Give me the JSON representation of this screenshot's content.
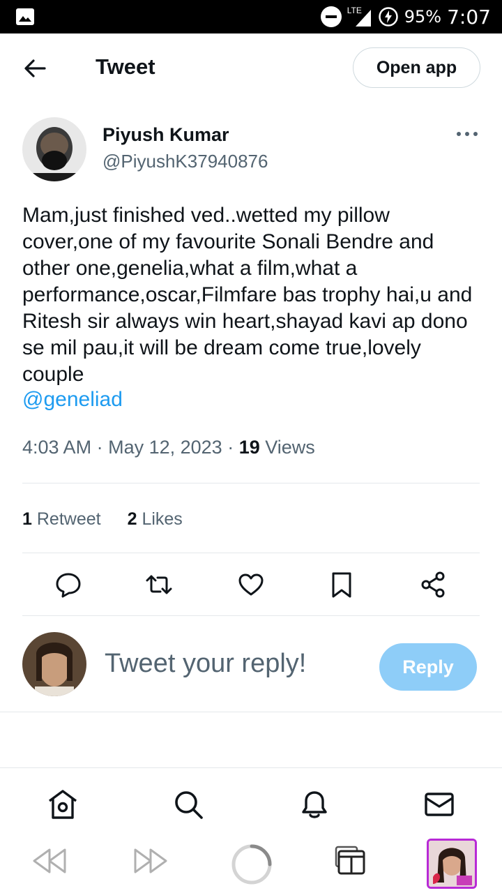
{
  "status_bar": {
    "network": "LTE",
    "battery": "95%",
    "time": "7:07"
  },
  "header": {
    "title": "Tweet",
    "open_app_label": "Open app"
  },
  "tweet": {
    "author_name": "Piyush Kumar",
    "author_handle": "@PiyushK37940876",
    "text": "Mam,just finished ved..wetted my pillow cover,one of my favourite Sonali Bendre and other one,genelia,what a film,what a performance,oscar,Filmfare bas trophy hai,u and Ritesh sir always win heart,shayad kavi ap dono se mil pau,it will be dream come true,lovely couple",
    "mention": "@geneliad",
    "time": "4:03 AM",
    "date": "May 12, 2023",
    "views_count": "19",
    "views_label": "Views",
    "retweets_count": "1",
    "retweets_label": "Retweet",
    "likes_count": "2",
    "likes_label": "Likes"
  },
  "reply": {
    "placeholder": "Tweet your reply!",
    "button_label": "Reply"
  },
  "colors": {
    "accent": "#1d9bf0",
    "reply_button": "#8ecdf8",
    "secondary_text": "#536471"
  },
  "icons": {
    "actions": [
      "reply-icon",
      "retweet-icon",
      "like-icon",
      "bookmark-icon",
      "share-icon"
    ],
    "nav": [
      "home-icon",
      "search-icon",
      "notifications-icon",
      "messages-icon"
    ],
    "browser": [
      "back-icon",
      "forward-icon",
      "loading-icon",
      "tabs-icon",
      "profile-icon"
    ]
  }
}
